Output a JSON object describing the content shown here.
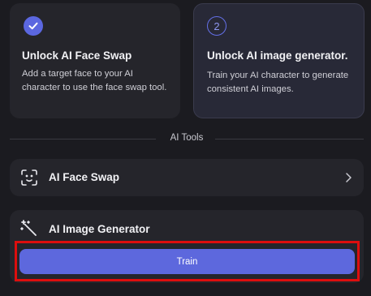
{
  "steps": [
    {
      "state": "completed",
      "title": "Unlock AI Face Swap",
      "description": "Add a target face to your AI character to use the face swap tool."
    },
    {
      "state": "current",
      "number": "2",
      "title": "Unlock AI image generator.",
      "description": "Train your AI character to generate consistent AI images."
    }
  ],
  "tools": {
    "section_label": "AI Tools",
    "face_swap": {
      "label": "AI Face Swap",
      "icon": "face-scan-icon"
    },
    "image_generator": {
      "label": "AI Image Generator",
      "icon": "magic-wand-icon"
    },
    "train_label": "Train"
  },
  "colors": {
    "accent": "#5d68dd",
    "highlight": "#dd0e0e",
    "background": "#1b1b20",
    "card": "#25252b"
  }
}
